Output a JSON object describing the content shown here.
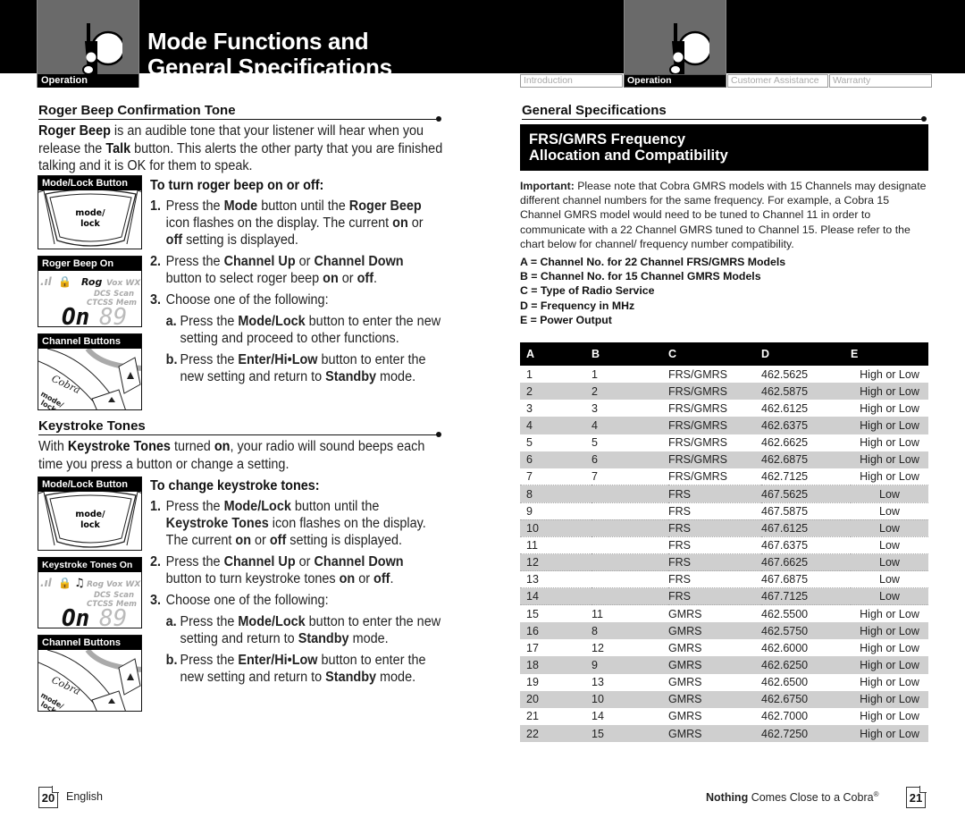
{
  "header": {
    "title_line1": "Mode Functions and",
    "title_line2": "General Specifications",
    "left_section_label": "Operation",
    "nav_tabs": [
      {
        "label": "Introduction",
        "active": false
      },
      {
        "label": "Operation",
        "active": true
      },
      {
        "label": "Customer Assistance",
        "active": false
      },
      {
        "label": "Warranty",
        "active": false
      }
    ]
  },
  "left_page": {
    "roger_beep": {
      "heading": "Roger Beep Confirmation Tone",
      "intro_bold1": "Roger Beep",
      "intro_1": " is an audible tone that your listener will hear when you release the ",
      "intro_bold2": "Talk",
      "intro_2": " button. This alerts the other party that you are finished talking and it is OK for them to speak.",
      "subheading": "To turn roger beep on or off:",
      "steps": [
        {
          "num": "1.",
          "parts": [
            [
              "Press the ",
              false
            ],
            [
              "Mode",
              true
            ],
            [
              " button until the ",
              false
            ],
            [
              "Roger Beep",
              true
            ],
            [
              " icon flashes on the display. The current ",
              false
            ],
            [
              "on",
              true
            ],
            [
              " or ",
              false
            ],
            [
              "off",
              true
            ],
            [
              " setting is displayed.",
              false
            ]
          ]
        },
        {
          "num": "2.",
          "parts": [
            [
              "Press the ",
              false
            ],
            [
              "Channel Up",
              true
            ],
            [
              " or ",
              false
            ],
            [
              "Channel Down",
              true
            ],
            [
              " button to select roger beep ",
              false
            ],
            [
              "on",
              true
            ],
            [
              " or ",
              false
            ],
            [
              "off",
              true
            ],
            [
              ".",
              false
            ]
          ]
        },
        {
          "num": "3.",
          "parts": [
            [
              "Choose one of the following:",
              false
            ]
          ]
        }
      ],
      "substeps": [
        {
          "num": "a.",
          "parts": [
            [
              "Press the ",
              false
            ],
            [
              "Mode/Lock",
              true
            ],
            [
              " button to enter the new setting and proceed to other functions.",
              false
            ]
          ]
        },
        {
          "num": "b.",
          "parts": [
            [
              "Press the ",
              false
            ],
            [
              "Enter/Hi•Low",
              true
            ],
            [
              " button to enter the new setting and return to ",
              false
            ],
            [
              "Standby",
              true
            ],
            [
              " mode.",
              false
            ]
          ]
        }
      ],
      "panels": [
        "Mode/Lock Button",
        "Roger Beep On",
        "Channel Buttons"
      ]
    },
    "keystroke": {
      "heading": "Keystroke Tones",
      "intro_1": "With ",
      "intro_bold1": "Keystroke Tones",
      "intro_2": " turned ",
      "intro_bold2": "on",
      "intro_3": ", your radio will sound beeps each time you press a button or change a setting.",
      "subheading": "To change keystroke tones:",
      "steps": [
        {
          "num": "1.",
          "parts": [
            [
              "Press the ",
              false
            ],
            [
              "Mode/Lock",
              true
            ],
            [
              " button until the ",
              false
            ],
            [
              "Keystroke Tones",
              true
            ],
            [
              " icon flashes on the display. The current ",
              false
            ],
            [
              "on",
              true
            ],
            [
              " or ",
              false
            ],
            [
              "off",
              true
            ],
            [
              " setting is displayed.",
              false
            ]
          ]
        },
        {
          "num": "2.",
          "parts": [
            [
              "Press the ",
              false
            ],
            [
              "Channel Up",
              true
            ],
            [
              " or ",
              false
            ],
            [
              "Channel Down",
              true
            ],
            [
              " button to turn keystroke tones ",
              false
            ],
            [
              "on",
              true
            ],
            [
              " or ",
              false
            ],
            [
              "off",
              true
            ],
            [
              ".",
              false
            ]
          ]
        },
        {
          "num": "3.",
          "parts": [
            [
              "Choose one of the following:",
              false
            ]
          ]
        }
      ],
      "substeps": [
        {
          "num": "a.",
          "parts": [
            [
              "Press the ",
              false
            ],
            [
              "Mode/Lock",
              true
            ],
            [
              " button to enter the new setting and return to ",
              false
            ],
            [
              "Standby",
              true
            ],
            [
              " mode.",
              false
            ]
          ]
        },
        {
          "num": "b.",
          "parts": [
            [
              "Press the ",
              false
            ],
            [
              "Enter/Hi•Low",
              true
            ],
            [
              " button to enter the new setting and return to ",
              false
            ],
            [
              "Standby",
              true
            ],
            [
              " mode.",
              false
            ]
          ]
        }
      ],
      "panels": [
        "Mode/Lock Button",
        "Keystroke Tones On",
        "Channel Buttons"
      ]
    },
    "illustration_text": {
      "mode_key_line1": "mode/",
      "mode_key_line2": "lock",
      "lcd_rog": "Rog",
      "lcd_vox": "Vox WX",
      "lcd_dcs": "DCS  Scan",
      "lcd_ctcss": "CTCSS Mem",
      "lcd_on": "On",
      "lcd_digits": "89",
      "brand": "Cobra"
    }
  },
  "right_page": {
    "heading": "General Specifications",
    "box_title_line1": "FRS/GMRS Frequency",
    "box_title_line2": "Allocation and Compatibility",
    "important_label": "Important:",
    "important_text": " Please note that Cobra GMRS models with 15 Channels may designate different channel numbers for the same frequency. For example, a Cobra 15 Channel GMRS model would need to be tuned to Channel 11 in order to communicate with a 22 Channel GMRS tuned to Channel 15. Please refer to the chart below for channel/ frequency number compatibility.",
    "legend": [
      "A = Channel No. for 22 Channel FRS/GMRS Models",
      "B = Channel No. for 15 Channel GMRS Models",
      "C = Type of Radio Service",
      "D = Frequency in MHz",
      "E = Power Output"
    ],
    "table": {
      "headers": [
        "A",
        "B",
        "C",
        "D",
        "E"
      ],
      "rows": [
        [
          "1",
          "1",
          "FRS/GMRS",
          "462.5625",
          "High or Low"
        ],
        [
          "2",
          "2",
          "FRS/GMRS",
          "462.5875",
          "High or Low"
        ],
        [
          "3",
          "3",
          "FRS/GMRS",
          "462.6125",
          "High or Low"
        ],
        [
          "4",
          "4",
          "FRS/GMRS",
          "462.6375",
          "High or Low"
        ],
        [
          "5",
          "5",
          "FRS/GMRS",
          "462.6625",
          "High or Low"
        ],
        [
          "6",
          "6",
          "FRS/GMRS",
          "462.6875",
          "High or Low"
        ],
        [
          "7",
          "7",
          "FRS/GMRS",
          "462.7125",
          "High or Low"
        ],
        [
          "8",
          "",
          "FRS",
          "467.5625",
          "Low"
        ],
        [
          "9",
          "",
          "FRS",
          "467.5875",
          "Low"
        ],
        [
          "10",
          "",
          "FRS",
          "467.6125",
          "Low"
        ],
        [
          "11",
          "",
          "FRS",
          "467.6375",
          "Low"
        ],
        [
          "12",
          "",
          "FRS",
          "467.6625",
          "Low"
        ],
        [
          "13",
          "",
          "FRS",
          "467.6875",
          "Low"
        ],
        [
          "14",
          "",
          "FRS",
          "467.7125",
          "Low"
        ],
        [
          "15",
          "11",
          "GMRS",
          "462.5500",
          "High or Low"
        ],
        [
          "16",
          "8",
          "GMRS",
          "462.5750",
          "High or Low"
        ],
        [
          "17",
          "12",
          "GMRS",
          "462.6000",
          "High or Low"
        ],
        [
          "18",
          "9",
          "GMRS",
          "462.6250",
          "High or Low"
        ],
        [
          "19",
          "13",
          "GMRS",
          "462.6500",
          "High or Low"
        ],
        [
          "20",
          "10",
          "GMRS",
          "462.6750",
          "High or Low"
        ],
        [
          "21",
          "14",
          "GMRS",
          "462.7000",
          "High or Low"
        ],
        [
          "22",
          "15",
          "GMRS",
          "462.7250",
          "High or Low"
        ]
      ]
    }
  },
  "footer": {
    "left_page_number": "20",
    "left_language": "English",
    "right_tagline_bold": "Nothing",
    "right_tagline": " Comes Close to a Cobra",
    "right_tagline_mark": "®",
    "right_page_number": "21"
  },
  "colors": {
    "header_black": "#000000",
    "tab_gray": "#6a6a6a",
    "row_alt": "#cfcfcf",
    "inactive_tab_text": "#aaaaaa"
  }
}
